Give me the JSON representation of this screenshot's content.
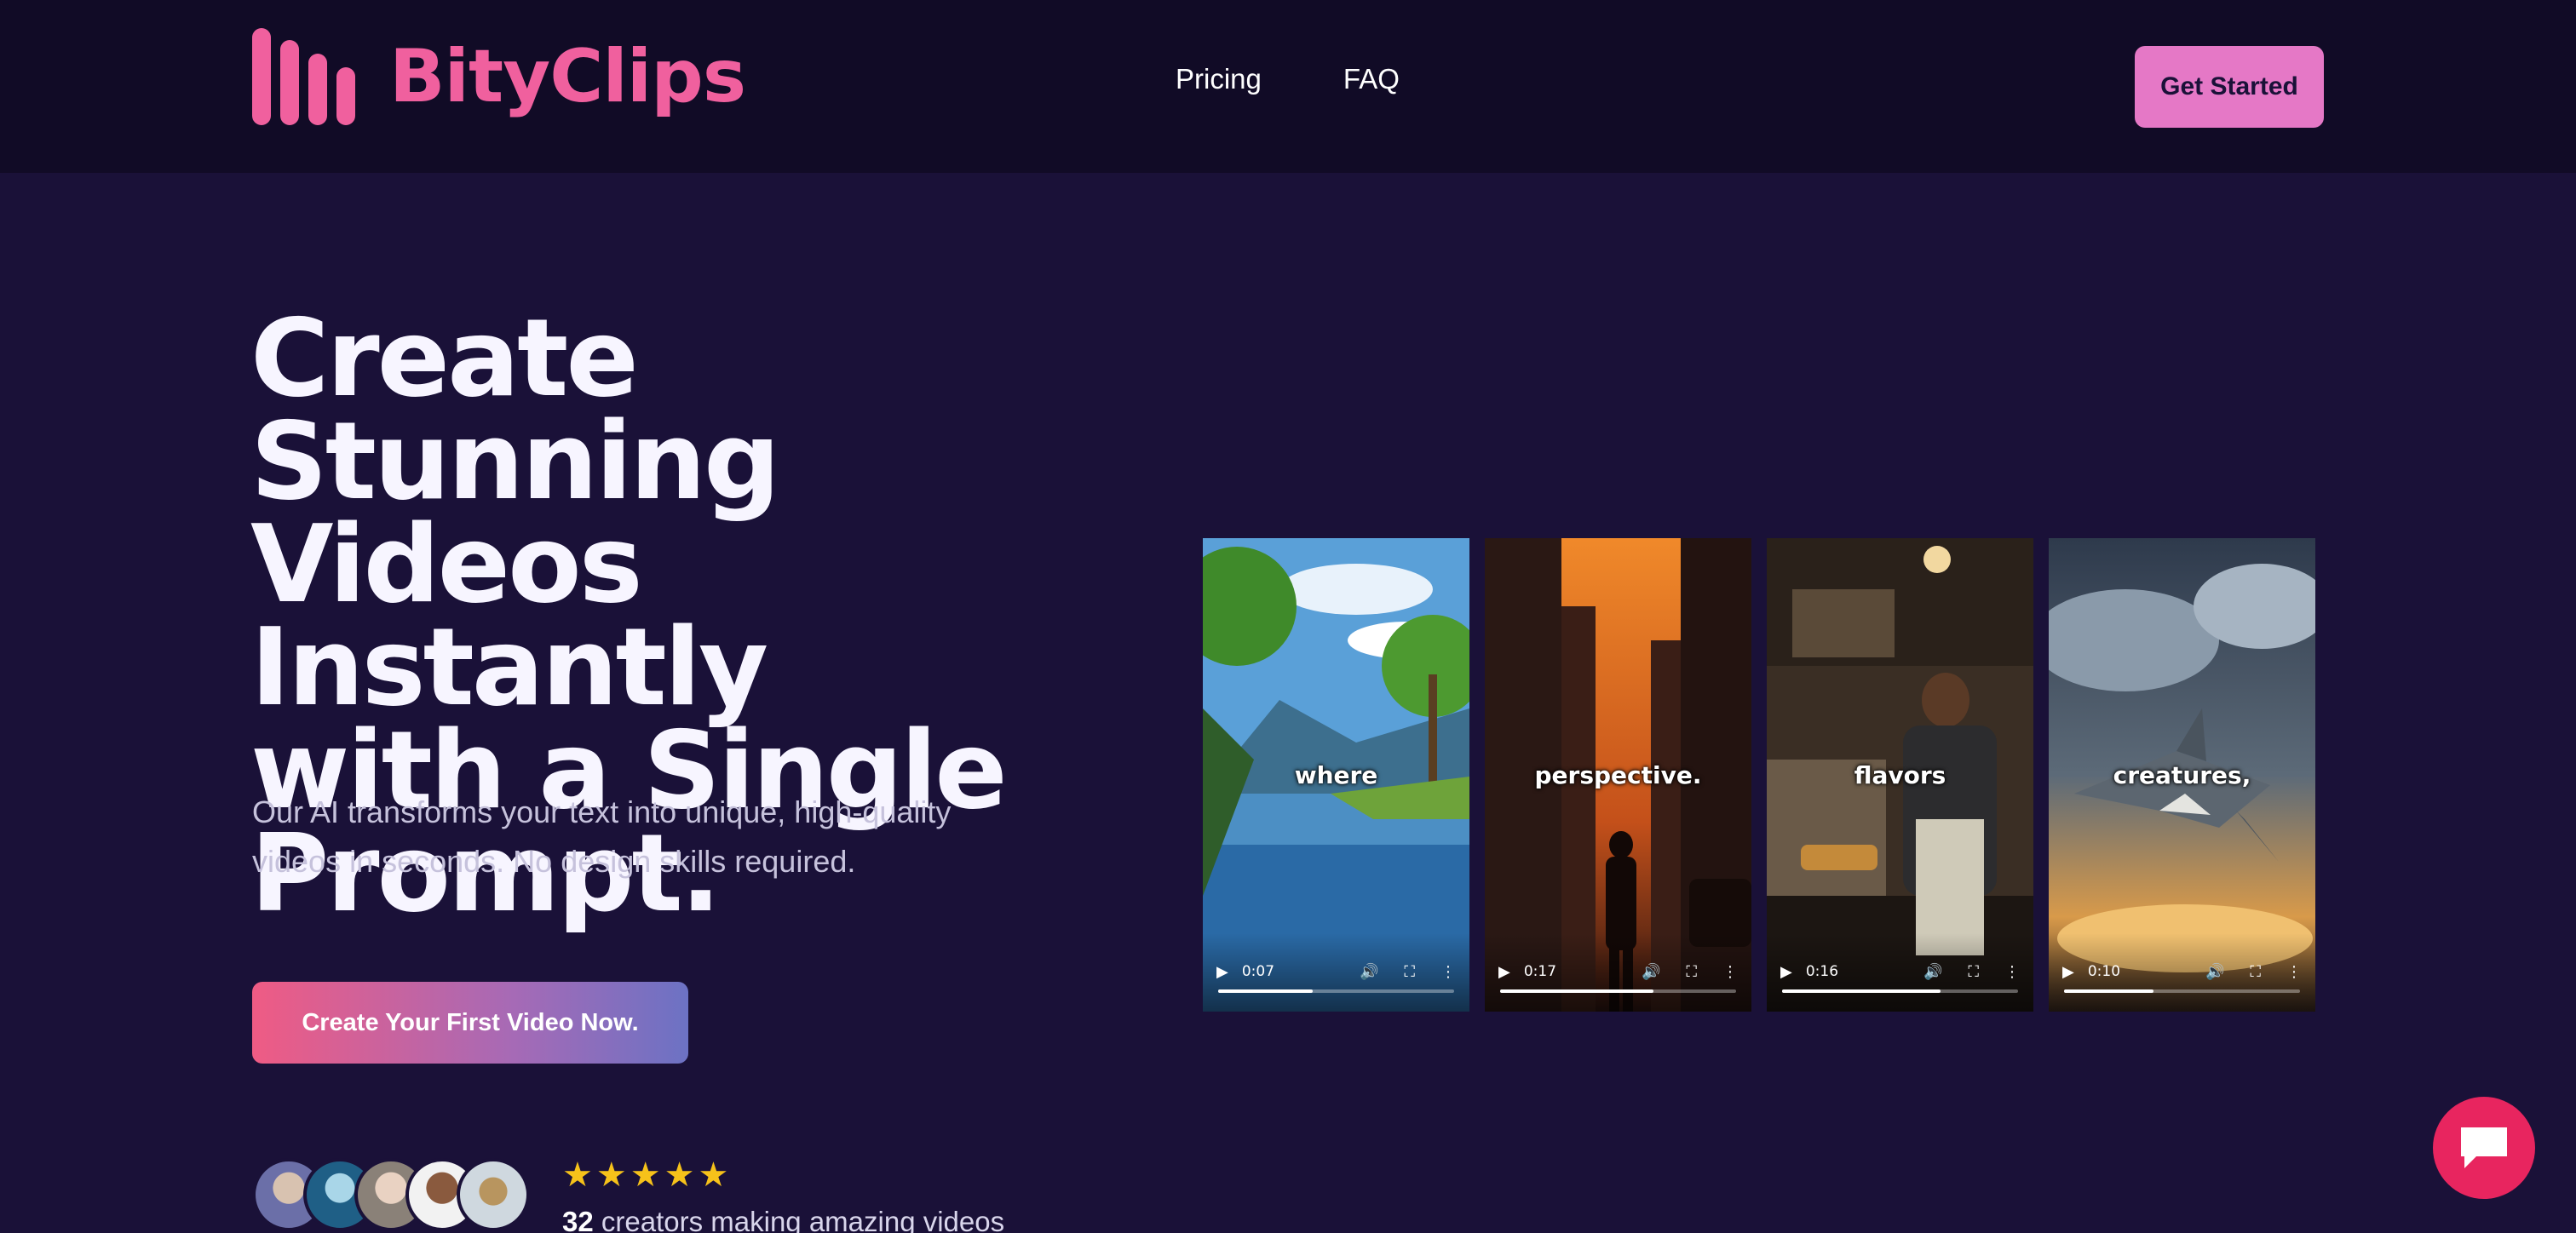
{
  "header": {
    "brand": "BityClips",
    "nav": [
      "Pricing",
      "FAQ"
    ],
    "cta_label": "Get Started"
  },
  "hero": {
    "headline_lines": [
      "Create Stunning",
      "Videos Instantly",
      "with a Single",
      "Prompt."
    ],
    "subtext_lines": [
      "Our AI transforms your text into unique, high-quality",
      "videos in seconds. No design skills required."
    ],
    "cta_label": "Create Your First Video Now.",
    "rating_stars": 5,
    "creators_count": "32",
    "creators_text": "creators making amazing videos"
  },
  "videos": [
    {
      "caption": "where",
      "time": "0:07",
      "progress": 0.4
    },
    {
      "caption": "perspective.",
      "time": "0:17",
      "progress": 0.65
    },
    {
      "caption": "flavors",
      "time": "0:16",
      "progress": 0.67
    },
    {
      "caption": "creatures,",
      "time": "0:10",
      "progress": 0.38
    }
  ],
  "colors": {
    "background": "#1a1138",
    "header_bg": "#110b26",
    "brand_pink": "#f0609e",
    "get_started_bg": "#e578c6",
    "star": "#f6c21a",
    "chat_button": "#e8255f"
  },
  "icons": {
    "logo": "bars-logo-icon",
    "video_controls": [
      "play-icon",
      "volume-icon",
      "fullscreen-icon",
      "more-vertical-icon"
    ],
    "chat": "chat-bubble-icon"
  }
}
